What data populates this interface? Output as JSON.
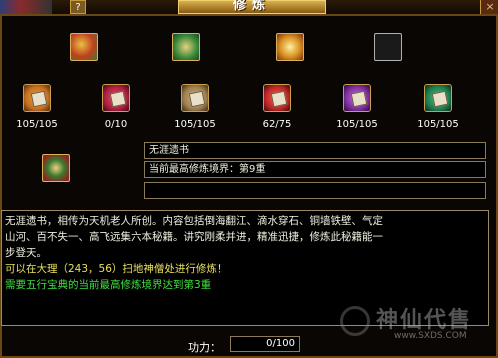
{
  "window": {
    "title": "修炼",
    "help_label": "?",
    "close_label": "×"
  },
  "top_items": [
    {
      "icon": "red-green-treasure-book-icon",
      "color": "#c04020"
    },
    {
      "icon": "green-gold-box-icon",
      "color": "#3a8a3a"
    },
    {
      "icon": "gold-treasure-chest-icon",
      "color": "#d89020"
    },
    {
      "icon": "empty-slot-icon",
      "color": "#202020"
    }
  ],
  "skill_books": [
    {
      "icon": "skill-book-orange-icon",
      "color": "#c87020",
      "count": "105/105"
    },
    {
      "icon": "skill-book-red-icon",
      "color": "#b02040",
      "count": "0/10"
    },
    {
      "icon": "skill-book-tan-icon",
      "color": "#a08050",
      "count": "105/105"
    },
    {
      "icon": "skill-book-crimson-icon",
      "color": "#c02828",
      "count": "62/75"
    },
    {
      "icon": "skill-book-purple-icon",
      "color": "#8030a0",
      "count": "105/105"
    },
    {
      "icon": "skill-book-green-icon",
      "color": "#208050",
      "count": "105/105"
    }
  ],
  "selected": {
    "icon": "green-red-treasure-box-icon",
    "name": "无涯遗书",
    "realm_line": "当前最高修炼境界：第9重",
    "extra_line": ""
  },
  "description": {
    "line1": "无涯遗书，相传为天机老人所创。内容包括倒海翻江、滴水穿石、铜墙铁壁、气定",
    "line2": "山河、百不失一、高飞远集六本秘籍。讲究刚柔并进，精准迅捷，修炼此秘籍能一",
    "line3": "步登天。",
    "location": "可以在大理（243，56）扫地神僧处进行修炼！",
    "requirement": "需要五行宝典的当前最高修炼境界达到第3重"
  },
  "colors": {
    "location_text": "#e8e060",
    "requirement_text": "#40e040"
  },
  "power": {
    "label": "功力：",
    "value": "0/100"
  },
  "watermark": {
    "text": "神仙代售",
    "url": "www.SXDS.COM"
  }
}
